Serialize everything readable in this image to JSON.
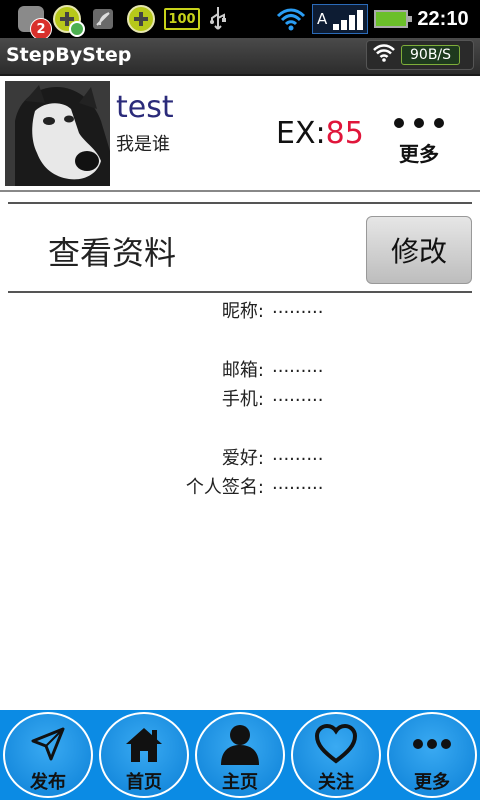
{
  "status_bar": {
    "badge_count": "2",
    "battery_indicator": "100",
    "signal_letter": "A",
    "time": "22:10",
    "icons": [
      "notification-badge-icon",
      "add-app-icon",
      "leaf-icon",
      "add-circle-icon",
      "battery-100-icon",
      "usb-icon",
      "wifi-icon",
      "signal-icon",
      "battery-icon"
    ]
  },
  "app_bar": {
    "title": "StepByStep",
    "net_speed": "90B/S"
  },
  "profile": {
    "username": "test",
    "subtitle": "我是谁",
    "ex_label": "EX:",
    "ex_value": "85",
    "more_label": "更多"
  },
  "section": {
    "title": "查看资料",
    "edit_button": "修改"
  },
  "fields": [
    {
      "label": "昵称:",
      "value": "........."
    },
    {
      "label": "邮箱:",
      "value": "........."
    },
    {
      "label": "手机:",
      "value": "........."
    },
    {
      "label": "爱好:",
      "value": "........."
    },
    {
      "label": "个人签名:",
      "value": "........."
    }
  ],
  "bottom_nav": {
    "items": [
      {
        "label": "发布",
        "icon": "send-icon"
      },
      {
        "label": "首页",
        "icon": "home-icon"
      },
      {
        "label": "主页",
        "icon": "user-icon"
      },
      {
        "label": "关注",
        "icon": "heart-icon"
      },
      {
        "label": "更多",
        "icon": "more-dots-icon"
      }
    ]
  },
  "colors": {
    "accent_blue": "#0b8be4",
    "ex_red": "#e0153a",
    "username_blue": "#2b2b7a"
  }
}
